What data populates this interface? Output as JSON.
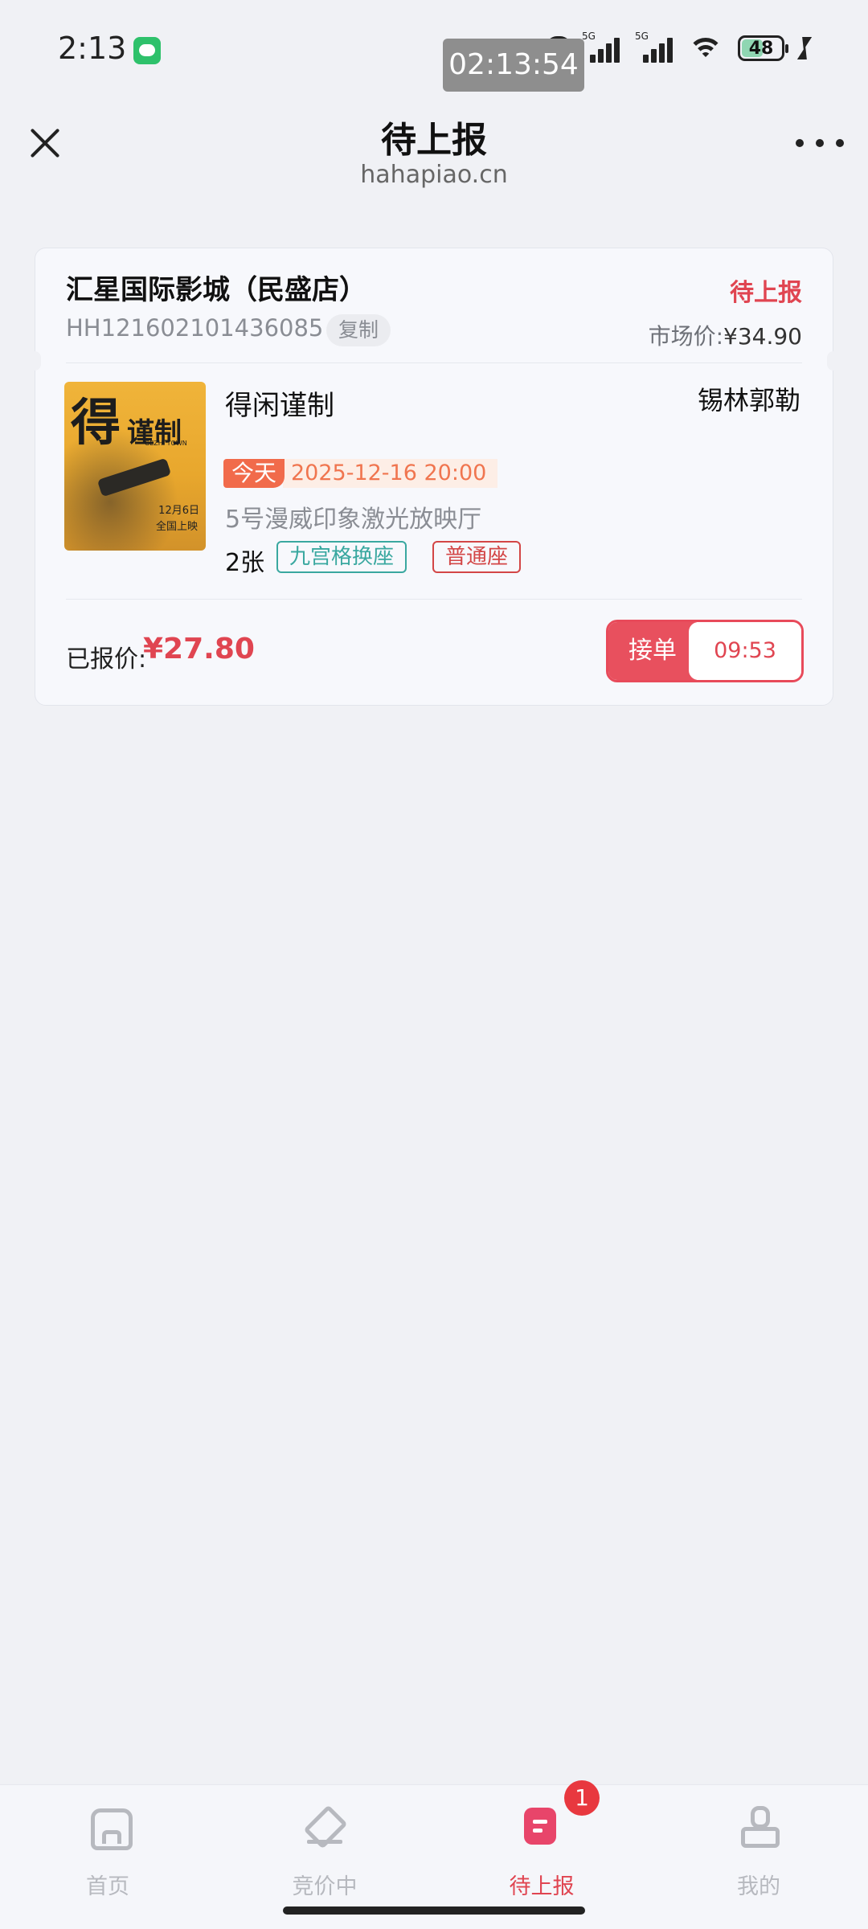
{
  "status_bar": {
    "time": "2:13",
    "overlay_clock": "02:13:54",
    "battery": "48",
    "network_tag_1": "5G",
    "network_tag_2": "5G"
  },
  "nav": {
    "title": "待上报",
    "subtitle": "hahapiao.cn"
  },
  "order": {
    "cinema": "汇星国际影城（民盛店）",
    "status": "待上报",
    "order_no": "HH121602101436085",
    "copy_label": "复制",
    "market_price_label": "市场价:",
    "market_price": "¥34.90",
    "movie_title": "得闲谨制",
    "actors": "锡林郭勒",
    "poster": {
      "title_char_1": "得",
      "title_part_2": "谨制",
      "english": "GEZHI TOWN",
      "date_line_1": "12月6日",
      "date_line_2": "全国上映"
    },
    "today_label": "今天",
    "showtime": "2025-12-16 20:00",
    "hall": "5号漫威印象激光放映厅",
    "tickets": "2张",
    "tag_seat_mode": "九宫格换座",
    "tag_seat_type": "普通座",
    "quoted_label": "已报价:",
    "quoted_price": "¥27.80",
    "accept_label": "接单",
    "countdown": "09:53"
  },
  "tabbar": {
    "items": [
      {
        "label": "首页",
        "icon": "home-icon",
        "active": false
      },
      {
        "label": "竞价中",
        "icon": "gavel-icon",
        "active": false
      },
      {
        "label": "待上报",
        "icon": "report-icon",
        "active": true,
        "badge": "1"
      },
      {
        "label": "我的",
        "icon": "user-icon",
        "active": false
      }
    ]
  },
  "colors": {
    "accent": "#e04551",
    "background": "#f0f1f5",
    "tag_green": "#3aa8a0",
    "today_orange": "#f16b4b"
  }
}
